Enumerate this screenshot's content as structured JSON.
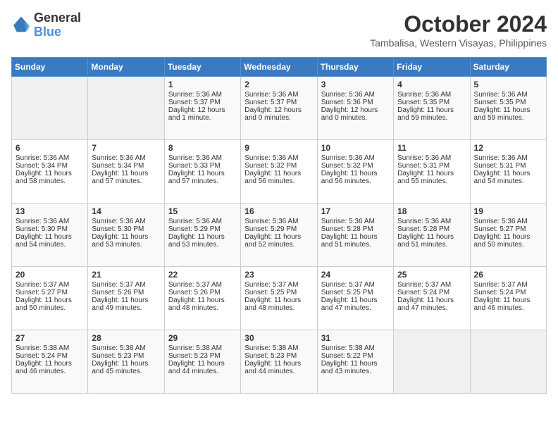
{
  "header": {
    "logo_line1": "General",
    "logo_line2": "Blue",
    "month": "October 2024",
    "location": "Tambalisa, Western Visayas, Philippines"
  },
  "days_of_week": [
    "Sunday",
    "Monday",
    "Tuesday",
    "Wednesday",
    "Thursday",
    "Friday",
    "Saturday"
  ],
  "weeks": [
    [
      {
        "day": "",
        "empty": true
      },
      {
        "day": "",
        "empty": true
      },
      {
        "day": "1",
        "sunrise": "Sunrise: 5:36 AM",
        "sunset": "Sunset: 5:37 PM",
        "daylight": "Daylight: 12 hours and 1 minute."
      },
      {
        "day": "2",
        "sunrise": "Sunrise: 5:36 AM",
        "sunset": "Sunset: 5:37 PM",
        "daylight": "Daylight: 12 hours and 0 minutes."
      },
      {
        "day": "3",
        "sunrise": "Sunrise: 5:36 AM",
        "sunset": "Sunset: 5:36 PM",
        "daylight": "Daylight: 12 hours and 0 minutes."
      },
      {
        "day": "4",
        "sunrise": "Sunrise: 5:36 AM",
        "sunset": "Sunset: 5:35 PM",
        "daylight": "Daylight: 11 hours and 59 minutes."
      },
      {
        "day": "5",
        "sunrise": "Sunrise: 5:36 AM",
        "sunset": "Sunset: 5:35 PM",
        "daylight": "Daylight: 11 hours and 59 minutes."
      }
    ],
    [
      {
        "day": "6",
        "sunrise": "Sunrise: 5:36 AM",
        "sunset": "Sunset: 5:34 PM",
        "daylight": "Daylight: 11 hours and 58 minutes."
      },
      {
        "day": "7",
        "sunrise": "Sunrise: 5:36 AM",
        "sunset": "Sunset: 5:34 PM",
        "daylight": "Daylight: 11 hours and 57 minutes."
      },
      {
        "day": "8",
        "sunrise": "Sunrise: 5:36 AM",
        "sunset": "Sunset: 5:33 PM",
        "daylight": "Daylight: 11 hours and 57 minutes."
      },
      {
        "day": "9",
        "sunrise": "Sunrise: 5:36 AM",
        "sunset": "Sunset: 5:32 PM",
        "daylight": "Daylight: 11 hours and 56 minutes."
      },
      {
        "day": "10",
        "sunrise": "Sunrise: 5:36 AM",
        "sunset": "Sunset: 5:32 PM",
        "daylight": "Daylight: 11 hours and 56 minutes."
      },
      {
        "day": "11",
        "sunrise": "Sunrise: 5:36 AM",
        "sunset": "Sunset: 5:31 PM",
        "daylight": "Daylight: 11 hours and 55 minutes."
      },
      {
        "day": "12",
        "sunrise": "Sunrise: 5:36 AM",
        "sunset": "Sunset: 5:31 PM",
        "daylight": "Daylight: 11 hours and 54 minutes."
      }
    ],
    [
      {
        "day": "13",
        "sunrise": "Sunrise: 5:36 AM",
        "sunset": "Sunset: 5:30 PM",
        "daylight": "Daylight: 11 hours and 54 minutes."
      },
      {
        "day": "14",
        "sunrise": "Sunrise: 5:36 AM",
        "sunset": "Sunset: 5:30 PM",
        "daylight": "Daylight: 11 hours and 53 minutes."
      },
      {
        "day": "15",
        "sunrise": "Sunrise: 5:36 AM",
        "sunset": "Sunset: 5:29 PM",
        "daylight": "Daylight: 11 hours and 53 minutes."
      },
      {
        "day": "16",
        "sunrise": "Sunrise: 5:36 AM",
        "sunset": "Sunset: 5:29 PM",
        "daylight": "Daylight: 11 hours and 52 minutes."
      },
      {
        "day": "17",
        "sunrise": "Sunrise: 5:36 AM",
        "sunset": "Sunset: 5:28 PM",
        "daylight": "Daylight: 11 hours and 51 minutes."
      },
      {
        "day": "18",
        "sunrise": "Sunrise: 5:36 AM",
        "sunset": "Sunset: 5:28 PM",
        "daylight": "Daylight: 11 hours and 51 minutes."
      },
      {
        "day": "19",
        "sunrise": "Sunrise: 5:36 AM",
        "sunset": "Sunset: 5:27 PM",
        "daylight": "Daylight: 11 hours and 50 minutes."
      }
    ],
    [
      {
        "day": "20",
        "sunrise": "Sunrise: 5:37 AM",
        "sunset": "Sunset: 5:27 PM",
        "daylight": "Daylight: 11 hours and 50 minutes."
      },
      {
        "day": "21",
        "sunrise": "Sunrise: 5:37 AM",
        "sunset": "Sunset: 5:26 PM",
        "daylight": "Daylight: 11 hours and 49 minutes."
      },
      {
        "day": "22",
        "sunrise": "Sunrise: 5:37 AM",
        "sunset": "Sunset: 5:26 PM",
        "daylight": "Daylight: 11 hours and 48 minutes."
      },
      {
        "day": "23",
        "sunrise": "Sunrise: 5:37 AM",
        "sunset": "Sunset: 5:25 PM",
        "daylight": "Daylight: 11 hours and 48 minutes."
      },
      {
        "day": "24",
        "sunrise": "Sunrise: 5:37 AM",
        "sunset": "Sunset: 5:25 PM",
        "daylight": "Daylight: 11 hours and 47 minutes."
      },
      {
        "day": "25",
        "sunrise": "Sunrise: 5:37 AM",
        "sunset": "Sunset: 5:24 PM",
        "daylight": "Daylight: 11 hours and 47 minutes."
      },
      {
        "day": "26",
        "sunrise": "Sunrise: 5:37 AM",
        "sunset": "Sunset: 5:24 PM",
        "daylight": "Daylight: 11 hours and 46 minutes."
      }
    ],
    [
      {
        "day": "27",
        "sunrise": "Sunrise: 5:38 AM",
        "sunset": "Sunset: 5:24 PM",
        "daylight": "Daylight: 11 hours and 46 minutes."
      },
      {
        "day": "28",
        "sunrise": "Sunrise: 5:38 AM",
        "sunset": "Sunset: 5:23 PM",
        "daylight": "Daylight: 11 hours and 45 minutes."
      },
      {
        "day": "29",
        "sunrise": "Sunrise: 5:38 AM",
        "sunset": "Sunset: 5:23 PM",
        "daylight": "Daylight: 11 hours and 44 minutes."
      },
      {
        "day": "30",
        "sunrise": "Sunrise: 5:38 AM",
        "sunset": "Sunset: 5:23 PM",
        "daylight": "Daylight: 11 hours and 44 minutes."
      },
      {
        "day": "31",
        "sunrise": "Sunrise: 5:38 AM",
        "sunset": "Sunset: 5:22 PM",
        "daylight": "Daylight: 11 hours and 43 minutes."
      },
      {
        "day": "",
        "empty": true
      },
      {
        "day": "",
        "empty": true
      }
    ]
  ]
}
